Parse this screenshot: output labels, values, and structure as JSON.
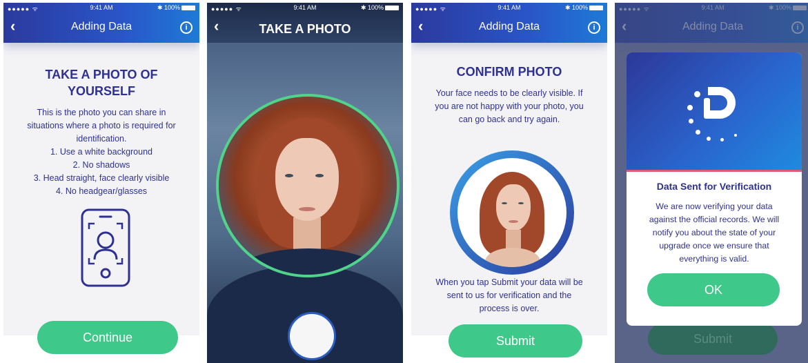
{
  "status": {
    "signal": "●●●●● ᯤ",
    "time": "9:41 AM",
    "battery": "✱ 100%"
  },
  "screen1": {
    "title": "Adding Data",
    "heading_line1": "TAKE A PHOTO OF",
    "heading_line2": "YOURSELF",
    "lines": [
      "This is the photo you can share in",
      "situations where a photo is required for",
      "identification.",
      "1. Use a white background",
      "2. No shadows",
      "3. Head straight, face clearly visible",
      "4. No headgear/glasses"
    ],
    "button": "Continue"
  },
  "screen2": {
    "title": "TAKE A PHOTO"
  },
  "screen3": {
    "title": "Adding Data",
    "heading": "CONFIRM PHOTO",
    "intro": [
      "Your face needs to be clearly visible. If",
      "you are not happy with your photo, you",
      "can go back and try again."
    ],
    "outro": [
      "When you tap Submit your data will be",
      "sent to us for verification and the",
      "process is over."
    ],
    "button": "Submit"
  },
  "screen4": {
    "title": "Adding Data",
    "modal_title": "Data Sent for Verification",
    "modal_lines": [
      "We are now verifying your data",
      "against the official records. We will",
      "notify you about the state of your",
      "upgrade once we ensure that",
      "everything is valid."
    ],
    "ok": "OK",
    "bg_button": "Submit"
  },
  "colors": {
    "brand_blue": "#2e3192",
    "green": "#3ec889",
    "accent_pink": "#e05a73"
  }
}
